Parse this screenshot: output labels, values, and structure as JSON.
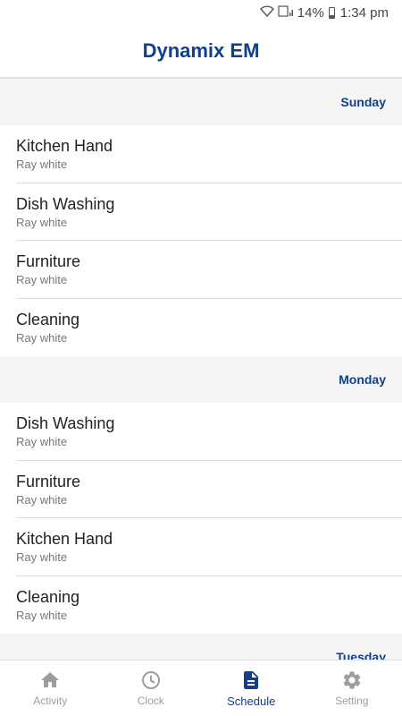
{
  "status_bar": {
    "battery": "14%",
    "time": "1:34 pm"
  },
  "header": {
    "title": "Dynamix EM"
  },
  "days": [
    {
      "day": "Sunday",
      "items": [
        {
          "title": "Kitchen Hand",
          "sub": "Ray white"
        },
        {
          "title": "Dish Washing",
          "sub": "Ray white"
        },
        {
          "title": "Furniture",
          "sub": "Ray white"
        },
        {
          "title": "Cleaning",
          "sub": "Ray white"
        }
      ]
    },
    {
      "day": "Monday",
      "items": [
        {
          "title": "Dish Washing",
          "sub": "Ray white"
        },
        {
          "title": "Furniture",
          "sub": "Ray white"
        },
        {
          "title": "Kitchen Hand",
          "sub": "Ray white"
        },
        {
          "title": "Cleaning",
          "sub": "Ray white"
        }
      ]
    },
    {
      "day": "Tuesday",
      "items": []
    }
  ],
  "bottom_nav": {
    "items": [
      {
        "label": "Activity",
        "icon": "home-icon",
        "active": false
      },
      {
        "label": "Clock",
        "icon": "clock-icon",
        "active": false
      },
      {
        "label": "Schedule",
        "icon": "document-icon",
        "active": true
      },
      {
        "label": "Setting",
        "icon": "gear-icon",
        "active": false
      }
    ]
  },
  "colors": {
    "brand": "#123f8a",
    "inactive": "#9e9e9e",
    "section_bg": "#f5f5f5"
  }
}
